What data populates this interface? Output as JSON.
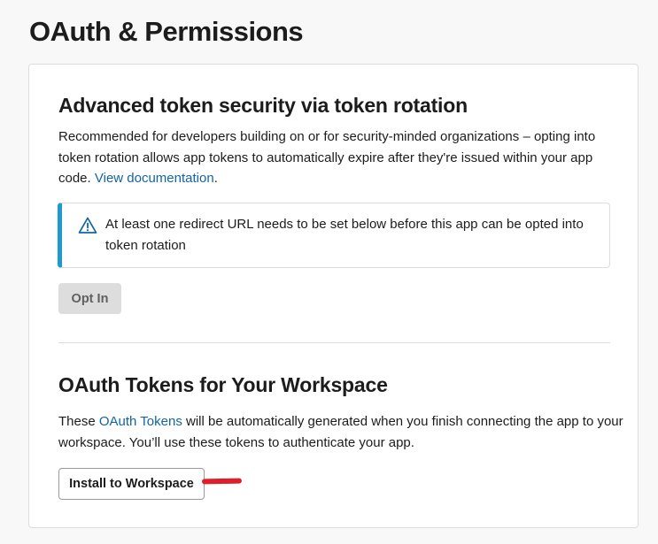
{
  "page": {
    "title": "OAuth & Permissions"
  },
  "token_rotation": {
    "title": "Advanced token security via token rotation",
    "description": "Recommended for developers building on or for security-minded organizations – opting into token rotation allows app tokens to automatically expire after they're issued within your app code.",
    "doc_link_label": "View documentation",
    "description_end": ".",
    "alert": {
      "icon": "warning-triangle-icon",
      "text": "At least one redirect URL needs to be set below before this app can be opted into token rotation",
      "accent_color": "#1d9bd1"
    },
    "opt_in_label": "Opt In"
  },
  "oauth_tokens": {
    "title": "OAuth Tokens for Your Workspace",
    "description_start": "These",
    "link_label": "OAuth Tokens",
    "description_end": "will be automatically generated when you finish connecting the app to your workspace. You’ll use these tokens to authenticate your app.",
    "install_label": "Install to Workspace"
  },
  "colors": {
    "link": "#1264a3",
    "annotation_mark": "#e01e2a"
  }
}
